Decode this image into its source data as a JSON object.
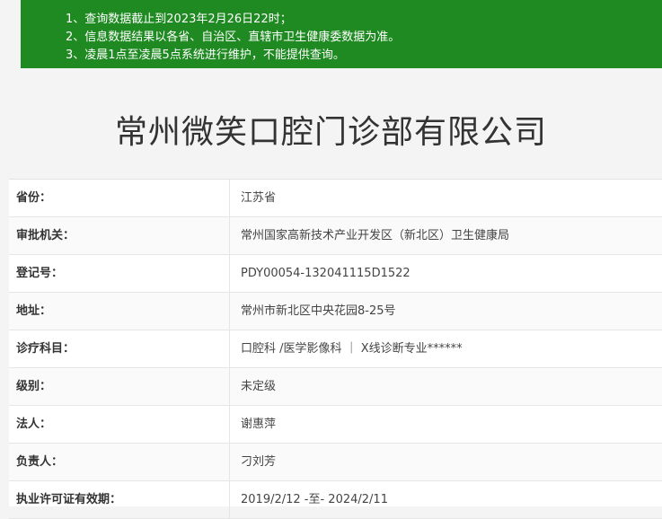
{
  "notice": {
    "line1": "1、查询数据截止到2023年2月26日22时；",
    "line2": "2、信息数据结果以各省、自治区、直辖市卫生健康委数据为准。",
    "line3": "3、凌晨1点至凌晨5点系统进行维护，不能提供查询。"
  },
  "title": "常州微笑口腔门诊部有限公司",
  "rows": [
    {
      "label": "省份：",
      "value": "江苏省"
    },
    {
      "label": "审批机关：",
      "value": "常州国家高新技术产业开发区（新北区）卫生健康局"
    },
    {
      "label": "登记号：",
      "value": "PDY00054-132041115D1522"
    },
    {
      "label": "地址：",
      "value": "常州市新北区中央花园8-25号"
    },
    {
      "label": "诊疗科目：",
      "value": "口腔科 /医学影像科 ｜ X线诊断专业******"
    },
    {
      "label": "级别：",
      "value": "未定级"
    },
    {
      "label": "法人：",
      "value": "谢惠萍"
    },
    {
      "label": "负责人：",
      "value": "刁刘芳"
    },
    {
      "label": "执业许可证有效期：",
      "value": "2019/2/12 -至- 2024/2/11"
    }
  ]
}
